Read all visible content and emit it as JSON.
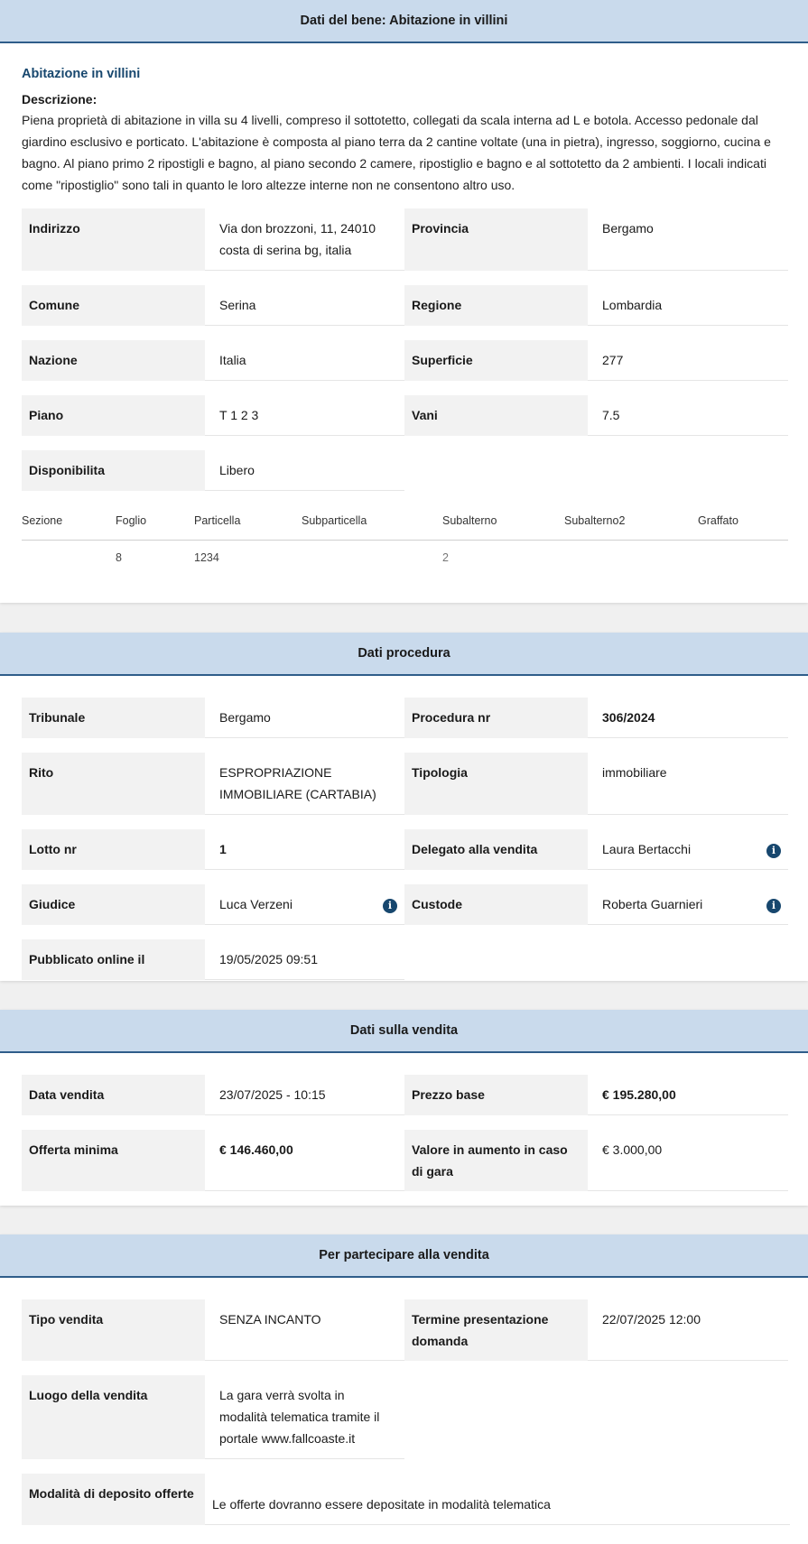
{
  "bene": {
    "header": "Dati del bene: Abitazione in villini",
    "subtitle": "Abitazione in villini",
    "desc_label": "Descrizione:",
    "desc_text": "Piena proprietà di abitazione in villa su 4 livelli, compreso il sottotetto, collegati da scala interna ad L e botola. Accesso pedonale dal giardino esclusivo e porticato. L'abitazione è composta al piano terra da 2 cantine voltate (una in pietra), ingresso, soggiorno, cucina e bagno. Al piano primo 2 ripostigli e bagno, al piano secondo 2 camere, ripostiglio e bagno e al sottotetto da 2 ambienti. I locali indicati come \"ripostiglio\" sono tali in quanto le loro altezze interne non ne consentono altro uso.",
    "fields": [
      {
        "label": "Indirizzo",
        "value": "Via don brozzoni, 11, 24010 costa di serina bg, italia"
      },
      {
        "label": "Provincia",
        "value": "Bergamo"
      },
      {
        "label": "Comune",
        "value": "Serina"
      },
      {
        "label": "Regione",
        "value": "Lombardia"
      },
      {
        "label": "Nazione",
        "value": "Italia"
      },
      {
        "label": "Superficie",
        "value": "277"
      },
      {
        "label": "Piano",
        "value": "T 1 2 3"
      },
      {
        "label": "Vani",
        "value": "7.5"
      },
      {
        "label": "Disponibilita",
        "value": "Libero"
      }
    ],
    "catasto": {
      "headers": [
        "Sezione",
        "Foglio",
        "Particella",
        "Subparticella",
        "Subalterno",
        "Subalterno2",
        "Graffato"
      ],
      "row": [
        "",
        "8",
        "1234",
        "",
        "2",
        "",
        ""
      ]
    }
  },
  "procedura": {
    "header": "Dati procedura",
    "fields": [
      {
        "label": "Tribunale",
        "value": "Bergamo"
      },
      {
        "label": "Procedura nr",
        "value": "306/2024"
      },
      {
        "label": "Rito",
        "value": "ESPROPRIAZIONE IMMOBILIARE (CARTABIA)"
      },
      {
        "label": "Tipologia",
        "value": "immobiliare"
      },
      {
        "label": "Lotto nr",
        "value": "1"
      },
      {
        "label": "Delegato alla vendita",
        "value": "Laura Bertacchi"
      },
      {
        "label": "Giudice",
        "value": "Luca Verzeni"
      },
      {
        "label": "Custode",
        "value": "Roberta Guarnieri"
      },
      {
        "label": "Pubblicato online il",
        "value": "19/05/2025 09:51"
      }
    ]
  },
  "vendita": {
    "header": "Dati sulla vendita",
    "fields": [
      {
        "label": "Data vendita",
        "value": "23/07/2025 - 10:15"
      },
      {
        "label": "Prezzo base",
        "value": "€ 195.280,00"
      },
      {
        "label": "Offerta minima",
        "value": "€ 146.460,00"
      },
      {
        "label": "Valore in aumento in caso di gara",
        "value": "€ 3.000,00"
      }
    ]
  },
  "partecipare": {
    "header": "Per partecipare alla vendita",
    "fields": [
      {
        "label": "Tipo vendita",
        "value": "SENZA INCANTO"
      },
      {
        "label": "Termine presentazione domanda",
        "value": "22/07/2025 12:00"
      },
      {
        "label": "Luogo della vendita",
        "value": "La gara verrà svolta in modalità telematica tramite il portale www.fallcoaste.it"
      },
      {
        "label": "Modalità di deposito offerte",
        "value": "Le offerte dovranno essere depositate in modalità telematica"
      }
    ]
  },
  "info_icon": "i"
}
